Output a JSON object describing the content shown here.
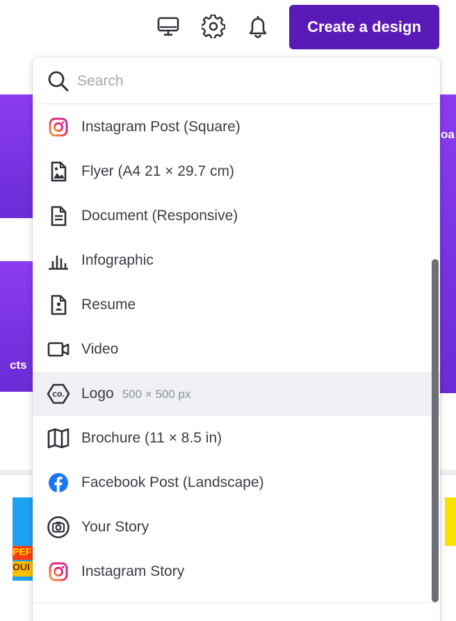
{
  "topbar": {
    "desktop_icon": "desktop-icon",
    "settings_icon": "gear-icon",
    "notifications_icon": "bell-icon",
    "create_button": "Create a design"
  },
  "background": {
    "right_text": "oa",
    "left_text": "cts",
    "thumb_text_1": "PEF",
    "thumb_text_2": "OUI"
  },
  "search": {
    "placeholder": "Search"
  },
  "items": [
    {
      "label": "Instagram Post (Square)",
      "icon": "instagram-icon"
    },
    {
      "label": "Flyer (A4 21 × 29.7 cm)",
      "icon": "flyer-icon"
    },
    {
      "label": "Document (Responsive)",
      "icon": "document-icon"
    },
    {
      "label": "Infographic",
      "icon": "infographic-icon"
    },
    {
      "label": "Resume",
      "icon": "resume-icon"
    },
    {
      "label": "Video",
      "icon": "video-icon"
    },
    {
      "label": "Logo",
      "sub": "500 × 500 px",
      "icon": "logo-icon"
    },
    {
      "label": "Brochure (11 × 8.5 in)",
      "icon": "map-icon"
    },
    {
      "label": "Facebook Post (Landscape)",
      "icon": "facebook-icon"
    },
    {
      "label": "Your Story",
      "icon": "camera-icon"
    },
    {
      "label": "Instagram Story",
      "icon": "instagram-icon"
    }
  ],
  "colors": {
    "brand": "#5a1ab8",
    "instagram_start": "#f9a03b",
    "instagram_end": "#e6246d",
    "facebook": "#1877f2",
    "icon": "#2c2f35"
  }
}
